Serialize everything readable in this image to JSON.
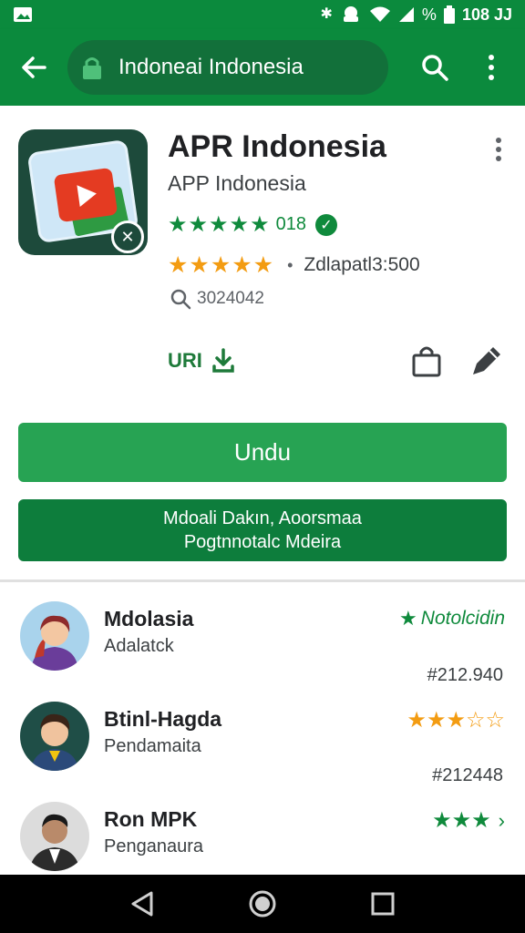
{
  "status_bar": {
    "left_icon": "image-icon",
    "percent": "%",
    "battery_text": "108 JJ"
  },
  "app_bar": {
    "url_text": "Indoneai Indonesia"
  },
  "app": {
    "title": "APR Indonesia",
    "developer": "APP Indonesia",
    "rating_stars": "★★★★★",
    "rating_count": "018",
    "rating2_stars": "★★★★★",
    "rating2_text": "Zdlapatl3:500",
    "downloads": "3024042",
    "url_label": "URI",
    "install_label": "Undu",
    "secondary_line1": "Mdoali Dakın, Aoorsmaa",
    "secondary_line2": "Pogtnnotalc Mdeira",
    "colors": {
      "primary": "#0b8a3d",
      "button": "#27a353",
      "button_dark": "#0d7d3c",
      "star": "#f39c12"
    }
  },
  "reviews": [
    {
      "name": "Mdolasia",
      "role": "Adalatck",
      "right_label": "Notolcidin",
      "right_icon": "star-icon",
      "number": "#212.940"
    },
    {
      "name": "Btinl-Hagda",
      "role": "Pendamaita",
      "right_label": "★★★☆☆",
      "number": "#212448"
    },
    {
      "name": "Ron MPK",
      "role": "Penganaura",
      "right_label": "★★★",
      "number": ""
    }
  ]
}
